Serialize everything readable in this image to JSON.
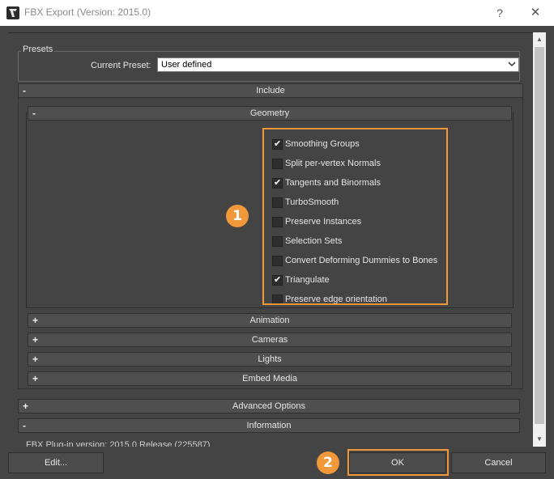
{
  "window": {
    "title": "FBX Export (Version: 2015.0)",
    "help_symbol": "?",
    "close_symbol": "✕"
  },
  "presets": {
    "group_label": "Presets",
    "current_preset_label": "Current Preset:",
    "current_preset_value": "User defined"
  },
  "rollouts": {
    "include": {
      "sign": "-",
      "title": "Include"
    },
    "geometry": {
      "sign": "-",
      "title": "Geometry"
    },
    "animation": {
      "sign": "+",
      "title": "Animation"
    },
    "cameras": {
      "sign": "+",
      "title": "Cameras"
    },
    "lights": {
      "sign": "+",
      "title": "Lights"
    },
    "embed_media": {
      "sign": "+",
      "title": "Embed Media"
    },
    "advanced_options": {
      "sign": "+",
      "title": "Advanced Options"
    },
    "information": {
      "sign": "-",
      "title": "Information"
    }
  },
  "geometry_options": [
    {
      "label": "Smoothing Groups",
      "checked": true
    },
    {
      "label": "Split per-vertex Normals",
      "checked": false
    },
    {
      "label": "Tangents and Binormals",
      "checked": true
    },
    {
      "label": "TurboSmooth",
      "checked": false
    },
    {
      "label": "Preserve Instances",
      "checked": false
    },
    {
      "label": "Selection Sets",
      "checked": false
    },
    {
      "label": "Convert Deforming Dummies to Bones",
      "checked": false
    },
    {
      "label": "Triangulate",
      "checked": true
    },
    {
      "label": "Preserve edge orientation",
      "checked": false
    }
  ],
  "check_glyph": "✔",
  "information": {
    "plugin_version": "FBX Plug-in version: 2015.0 Release (225587)"
  },
  "annotations": {
    "badge_1": "1",
    "badge_2": "2",
    "highlight_color": "#f0983a"
  },
  "buttons": {
    "edit": "Edit...",
    "ok": "OK",
    "cancel": "Cancel"
  },
  "scrollbar": {
    "up_arrow": "▲",
    "down_arrow": "▼"
  }
}
